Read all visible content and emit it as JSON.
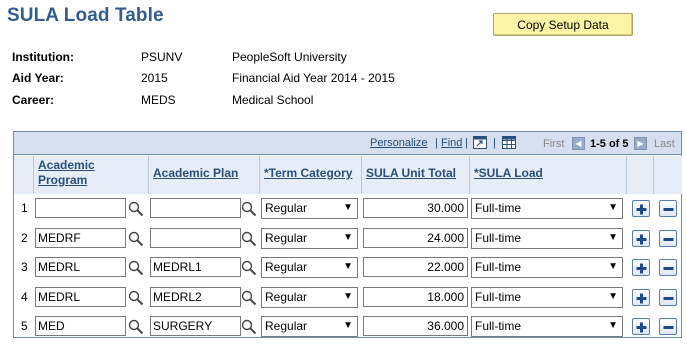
{
  "page": {
    "title": "SULA Load Table"
  },
  "toolbar": {
    "copy_label": "Copy Setup Data"
  },
  "info": [
    {
      "label": "Institution:",
      "code": "PSUNV",
      "desc": "PeopleSoft University"
    },
    {
      "label": "Aid Year:",
      "code": "2015",
      "desc": "Financial Aid Year 2014 - 2015"
    },
    {
      "label": "Career:",
      "code": "MEDS",
      "desc": "Medical School"
    }
  ],
  "grid": {
    "nav": {
      "personalize": "Personalize",
      "separator": "|",
      "find": "Find",
      "first": "First",
      "range": "1-5 of 5",
      "last": "Last"
    },
    "columns": {
      "program_line1": "Academic",
      "program_line2": "Program",
      "plan": "Academic Plan",
      "term": "*Term Category",
      "units": "SULA Unit Total",
      "load": "*SULA Load"
    },
    "rows": [
      {
        "num": "1",
        "program": "",
        "plan": "",
        "term": "Regular",
        "units": "30.000",
        "load": "Full-time"
      },
      {
        "num": "2",
        "program": "MEDRF",
        "plan": "",
        "term": "Regular",
        "units": "24.000",
        "load": "Full-time"
      },
      {
        "num": "3",
        "program": "MEDRL",
        "plan": "MEDRL1",
        "term": "Regular",
        "units": "22.000",
        "load": "Full-time"
      },
      {
        "num": "4",
        "program": "MEDRL",
        "plan": "MEDRL2",
        "term": "Regular",
        "units": "18.000",
        "load": "Full-time"
      },
      {
        "num": "5",
        "program": "MED",
        "plan": "SURGERY",
        "term": "Regular",
        "units": "36.000",
        "load": "Full-time"
      }
    ]
  },
  "icons": {
    "lookup": "magnifier-icon",
    "add": "plus-icon",
    "delete": "minus-icon",
    "accent": "#335d8d",
    "grid_header_bg": "#d5dff0",
    "button_bg": "#fbf4a5"
  }
}
